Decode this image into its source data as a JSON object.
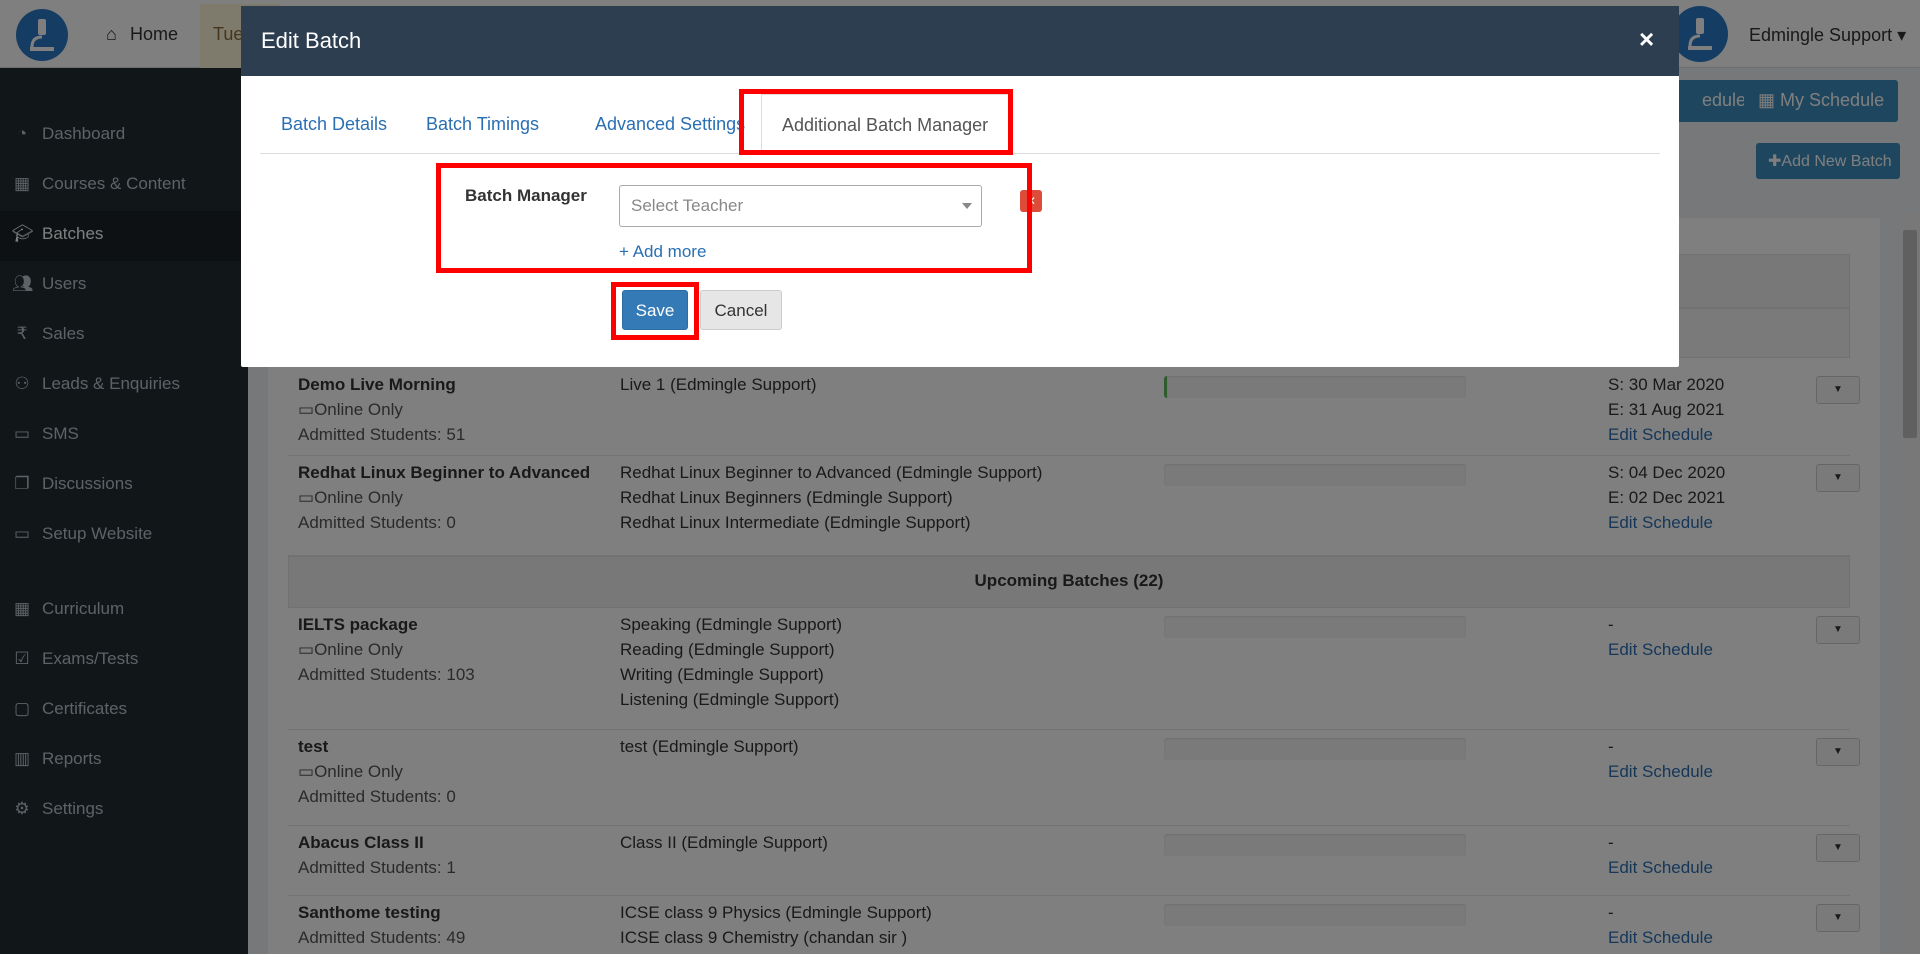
{
  "topbar": {
    "home_label": "Home",
    "tue_label": "Tue",
    "user_name": "Edmingle Support"
  },
  "sidebar": {
    "items": [
      {
        "label": "Dashboard",
        "icon": "dashboard-icon"
      },
      {
        "label": "Courses & Content",
        "icon": "courses-icon"
      },
      {
        "label": "Batches",
        "icon": "graduation-cap-icon"
      },
      {
        "label": "Users",
        "icon": "users-icon"
      },
      {
        "label": "Sales",
        "icon": "rupee-icon"
      },
      {
        "label": "Leads & Enquiries",
        "icon": "leads-icon"
      },
      {
        "label": "SMS",
        "icon": "sms-icon"
      },
      {
        "label": "Discussions",
        "icon": "comments-icon"
      },
      {
        "label": "Setup Website",
        "icon": "laptop-icon"
      },
      {
        "label": "Curriculum",
        "icon": "curriculum-icon"
      },
      {
        "label": "Exams/Tests",
        "icon": "check-square-icon"
      },
      {
        "label": "Certificates",
        "icon": "certificate-icon"
      },
      {
        "label": "Reports",
        "icon": "bar-chart-icon"
      },
      {
        "label": "Settings",
        "icon": "gear-icon"
      }
    ],
    "active_index": 2
  },
  "header_actions": {
    "schedule_partial": "edule",
    "my_schedule": "My Schedule",
    "add_new_batch": "Add New Batch"
  },
  "batches": {
    "rows": [
      {
        "name": "Demo Live Morning",
        "mode": "Online Only",
        "admitted_label": "Admitted Students:",
        "admitted": "51",
        "courses": [
          "Live 1 (Edmingle Support)"
        ],
        "start": "S: 30 Mar 2020",
        "end": "E: 31 Aug 2021",
        "edit": "Edit Schedule"
      },
      {
        "name": "Redhat Linux Beginner to Advanced",
        "mode": "Online Only",
        "admitted_label": "Admitted Students:",
        "admitted": "0",
        "courses": [
          "Redhat Linux Beginner to Advanced (Edmingle Support)",
          "Redhat Linux Beginners (Edmingle Support)",
          "Redhat Linux Intermediate (Edmingle Support)"
        ],
        "start": "S: 04 Dec 2020",
        "end": "E: 02 Dec 2021",
        "edit": "Edit Schedule"
      }
    ],
    "upcoming_header": "Upcoming Batches (22)",
    "upcoming": [
      {
        "name": "IELTS package",
        "mode": "Online Only",
        "admitted_label": "Admitted Students:",
        "admitted": "103",
        "courses": [
          "Speaking (Edmingle Support)",
          "Reading (Edmingle Support)",
          "Writing (Edmingle Support)",
          "Listening (Edmingle Support)"
        ],
        "dash": "-",
        "edit": "Edit Schedule"
      },
      {
        "name": "test",
        "mode": "Online Only",
        "admitted_label": "Admitted Students:",
        "admitted": "0",
        "courses": [
          "test (Edmingle Support)"
        ],
        "dash": "-",
        "edit": "Edit Schedule"
      },
      {
        "name": "Abacus Class II",
        "admitted_label": "Admitted Students:",
        "admitted": "1",
        "courses": [
          "Class II (Edmingle Support)"
        ],
        "dash": "-",
        "edit": "Edit Schedule"
      },
      {
        "name": "Santhome testing",
        "admitted_label": "Admitted Students:",
        "admitted": "49",
        "courses": [
          "ICSE class 9 Physics (Edmingle Support)",
          "ICSE class 9 Chemistry (chandan sir )"
        ],
        "dash": "-",
        "edit": "Edit Schedule"
      }
    ]
  },
  "modal": {
    "title": "Edit Batch",
    "close_glyph": "×",
    "tabs": [
      "Batch Details",
      "Batch Timings",
      "Advanced Settings",
      "Additional Batch Manager"
    ],
    "active_tab": 3,
    "field_label": "Batch Manager",
    "select_placeholder": "Select Teacher",
    "add_more": "+ Add more",
    "save": "Save",
    "cancel": "Cancel"
  },
  "colors": {
    "sidebar_bg": "#222d32",
    "modal_header": "#2c3e50",
    "primary": "#337ab7",
    "highlight": "#ff0000"
  }
}
